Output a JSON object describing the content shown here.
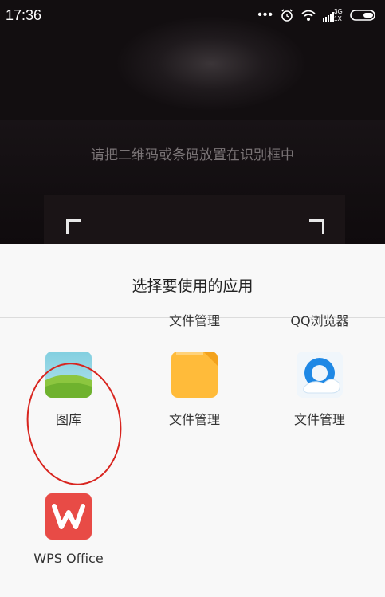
{
  "status_bar": {
    "time": "17:36",
    "network": "3G",
    "network_sub": "1X"
  },
  "scanner": {
    "hint": "请把二维码或条码放置在识别框中"
  },
  "chooser": {
    "title": "选择要使用的应用",
    "apps": [
      {
        "header": "",
        "label": "图库",
        "icon": "gallery-icon"
      },
      {
        "header": "文件管理",
        "label": "文件管理",
        "icon": "folder-icon"
      },
      {
        "header": "QQ浏览器",
        "label": "文件管理",
        "icon": "qq-browser-icon"
      },
      {
        "header": "",
        "label": "WPS Office",
        "icon": "wps-icon"
      }
    ]
  },
  "colors": {
    "highlight_circle": "#d8251f",
    "folder": "#ffbb3a",
    "wps": "#e84b46"
  }
}
